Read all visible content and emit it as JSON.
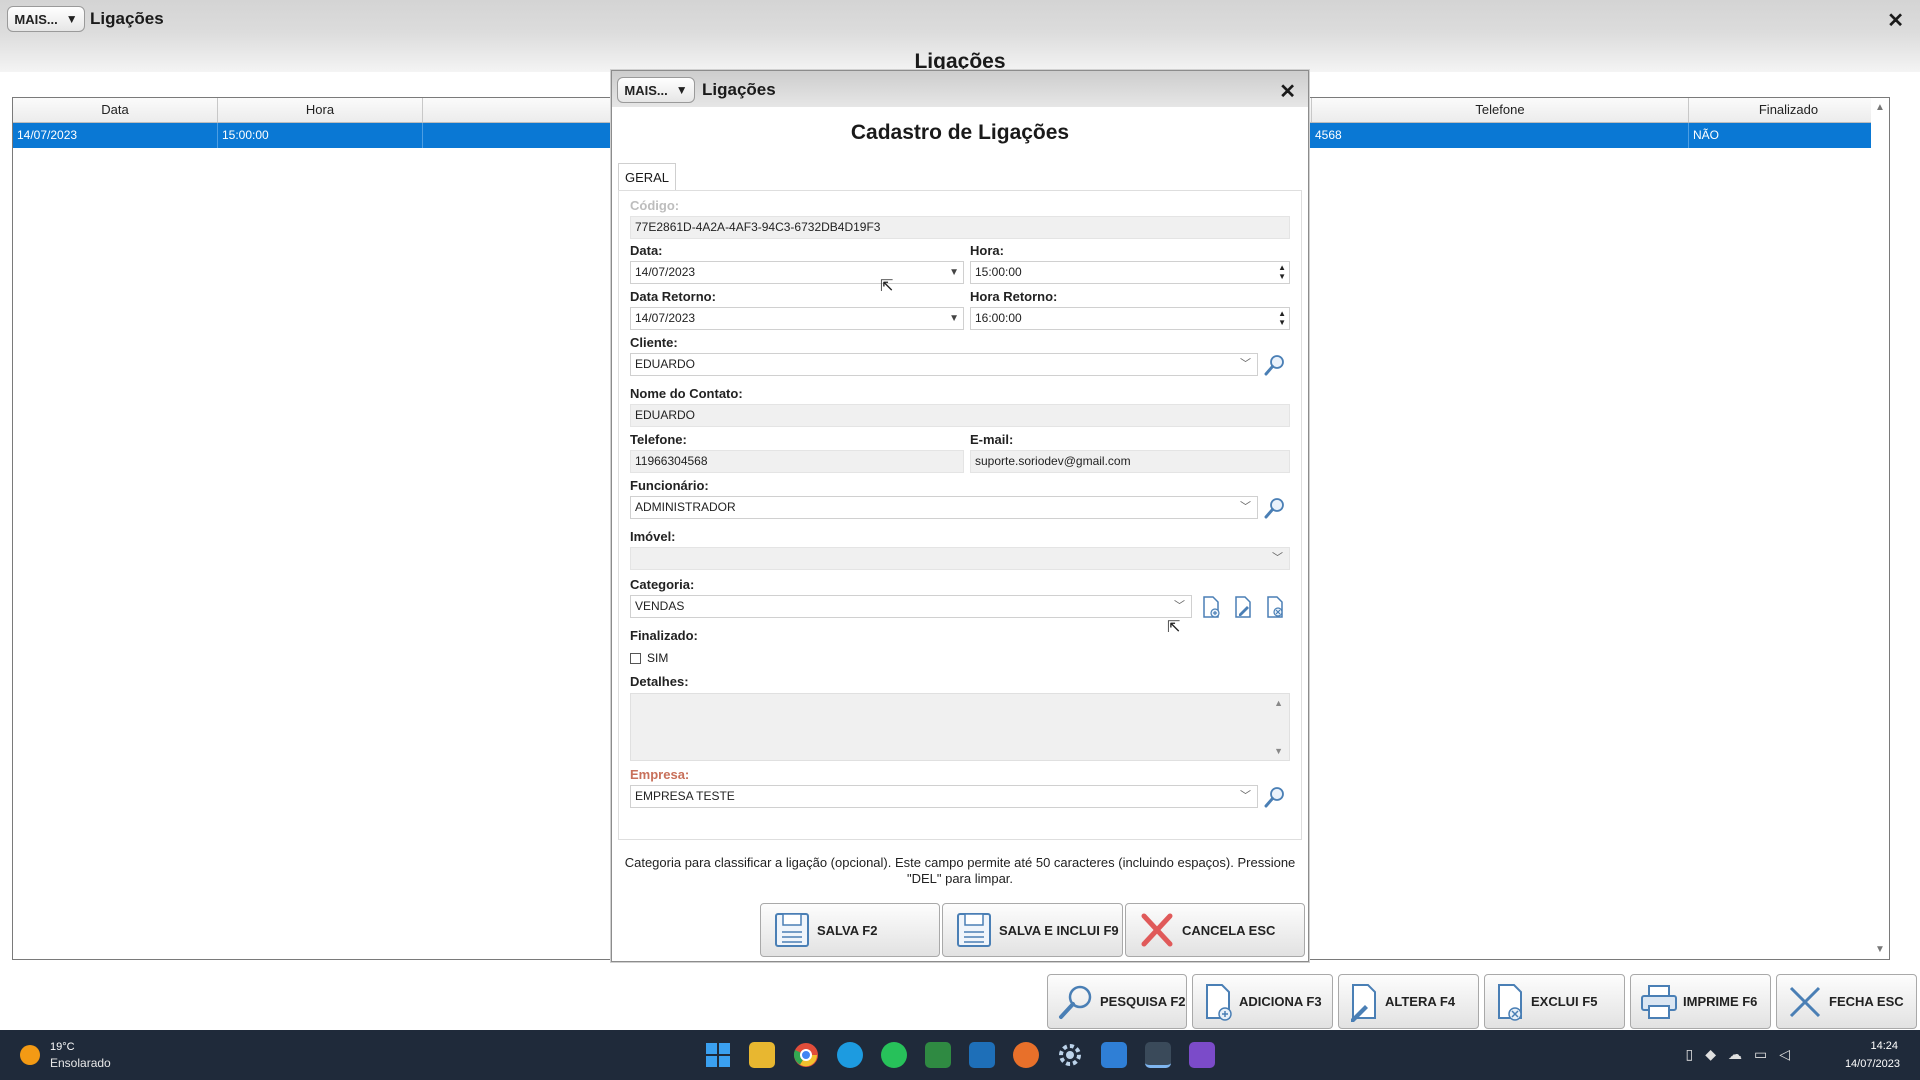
{
  "window": {
    "title": "Ligações",
    "mais_label": "MAIS...",
    "caret": "▼",
    "close": "✕",
    "heading": "Ligações"
  },
  "grid": {
    "columns": [
      "Data",
      "Hora",
      "Telefone",
      "Finalizado"
    ],
    "row": {
      "data": "14/07/2023",
      "hora": "15:00:00",
      "telefone": "4568",
      "finalizado": "NÃO"
    }
  },
  "toolbar": [
    {
      "label": "PESQUISA F2",
      "icon": "search-icon"
    },
    {
      "label": "ADICIONA F3",
      "icon": "add-doc-icon"
    },
    {
      "label": "ALTERA F4",
      "icon": "edit-doc-icon"
    },
    {
      "label": "EXCLUI F5",
      "icon": "delete-doc-icon"
    },
    {
      "label": "IMPRIME F6",
      "icon": "printer-icon"
    },
    {
      "label": "FECHA ESC",
      "icon": "close-x-icon"
    }
  ],
  "dialog": {
    "title": "Ligações",
    "mais_label": "MAIS...",
    "caret": "▼",
    "close": "✕",
    "heading": "Cadastro de Ligações",
    "tab": "GERAL",
    "codigo_label": "Código:",
    "codigo": "77E2861D-4A2A-4AF3-94C3-6732DB4D19F3",
    "data_label": "Data:",
    "data": "14/07/2023",
    "hora_label": "Hora:",
    "hora": "15:00:00",
    "data_retorno_label": "Data Retorno:",
    "data_retorno": "14/07/2023",
    "hora_retorno_label": "Hora Retorno:",
    "hora_retorno": "16:00:00",
    "cliente_label": "Cliente:",
    "cliente": "EDUARDO",
    "nome_contato_label": "Nome do Contato:",
    "nome_contato": "EDUARDO",
    "telefone_label": "Telefone:",
    "telefone": "11966304568",
    "email_label": "E-mail:",
    "email": "suporte.soriodev@gmail.com",
    "funcionario_label": "Funcionário:",
    "funcionario": "ADMINISTRADOR",
    "imovel_label": "Imóvel:",
    "imovel": "",
    "categoria_label": "Categoria:",
    "categoria": "VENDAS",
    "finalizado_label": "Finalizado:",
    "finalizado_option": "SIM",
    "detalhes_label": "Detalhes:",
    "empresa_label": "Empresa:",
    "empresa": "EMPRESA TESTE",
    "hint": "Categoria para classificar a ligação (opcional). Este campo permite até 50 caracteres (incluindo espaços). Pressione \"DEL\" para limpar.",
    "buttons": {
      "save": "SALVA F2",
      "save_new": "SALVA E INCLUI F9",
      "cancel": "CANCELA ESC"
    }
  },
  "taskbar": {
    "weather_temp": "19°C",
    "weather_desc": "Ensolarado",
    "time": "14:24",
    "date": "14/07/2023"
  },
  "colors": {
    "selection": "#0a78d4",
    "empresa_label": "#c8705a",
    "taskbar": "#1f2a3a"
  }
}
